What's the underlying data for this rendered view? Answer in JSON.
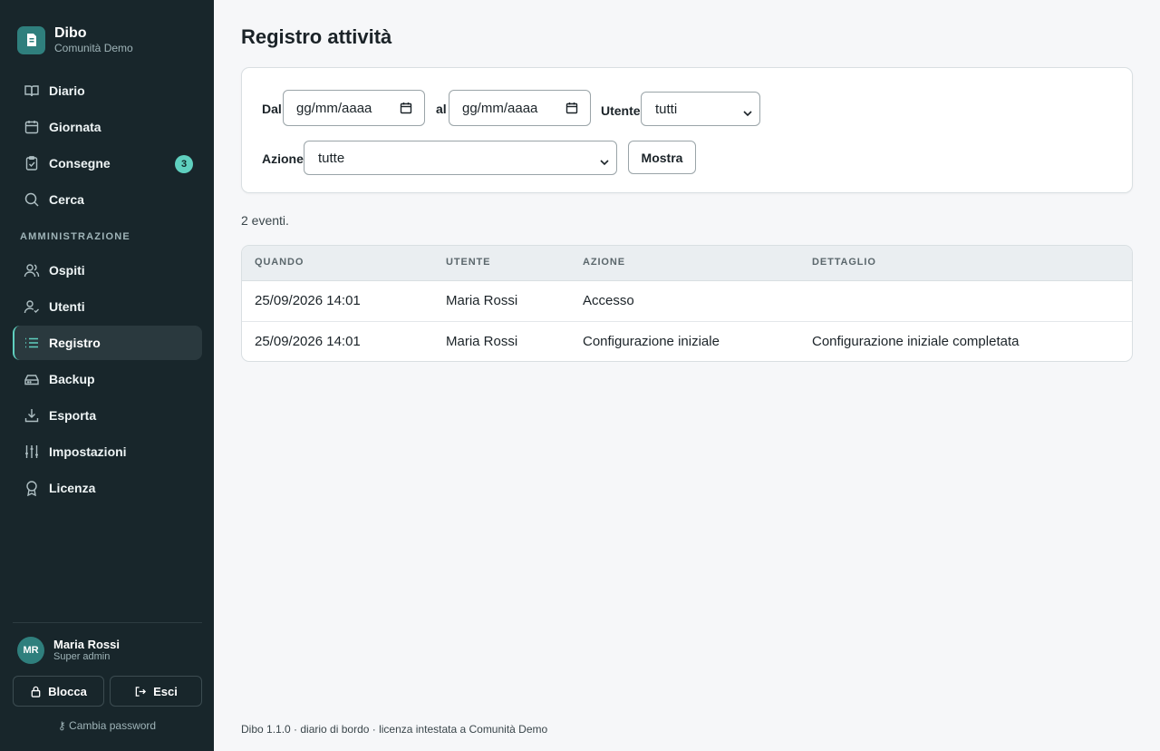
{
  "brand": {
    "name": "Dibo",
    "subtitle": "Comunità Demo"
  },
  "nav_main": [
    {
      "label": "Diario",
      "icon": "book-icon"
    },
    {
      "label": "Giornata",
      "icon": "calendar-icon"
    },
    {
      "label": "Consegne",
      "icon": "clipboard-icon",
      "badge": "3"
    },
    {
      "label": "Cerca",
      "icon": "search-icon"
    }
  ],
  "admin_section_label": "AMMINISTRAZIONE",
  "nav_admin": [
    {
      "label": "Ospiti",
      "icon": "users-icon"
    },
    {
      "label": "Utenti",
      "icon": "user-check-icon"
    },
    {
      "label": "Registro",
      "icon": "list-icon",
      "active": true
    },
    {
      "label": "Backup",
      "icon": "hard-drive-icon"
    },
    {
      "label": "Esporta",
      "icon": "download-icon"
    },
    {
      "label": "Impostazioni",
      "icon": "sliders-icon"
    },
    {
      "label": "Licenza",
      "icon": "award-icon"
    }
  ],
  "user": {
    "initials": "MR",
    "name": "Maria Rossi",
    "role": "Super admin"
  },
  "buttons": {
    "lock": "Blocca",
    "exit": "Esci",
    "change_password": "Cambia password"
  },
  "page": {
    "title": "Registro attività"
  },
  "filters": {
    "from_label": "Dal",
    "from_value": "gg/mm/aaaa",
    "to_label": "al",
    "to_value": "gg/mm/aaaa",
    "user_label": "Utente",
    "user_value": "tutti",
    "action_label": "Azione",
    "action_value": "tutte",
    "show_button": "Mostra"
  },
  "event_count": "2 eventi.",
  "table": {
    "headers": [
      "QUANDO",
      "UTENTE",
      "AZIONE",
      "DETTAGLIO"
    ],
    "rows": [
      [
        "25/09/2026 14:01",
        "Maria Rossi",
        "Accesso",
        ""
      ],
      [
        "25/09/2026 14:01",
        "Maria Rossi",
        "Configurazione iniziale",
        "Configurazione iniziale completata"
      ]
    ]
  },
  "footer": "Dibo 1.1.0 · diario di bordo · licenza intestata a Comunità Demo",
  "colors": {
    "sidebar_bg": "#18262b",
    "accent": "#5fd0bf",
    "brand": "#2f7f7d",
    "page_bg": "#f6f7f9"
  }
}
